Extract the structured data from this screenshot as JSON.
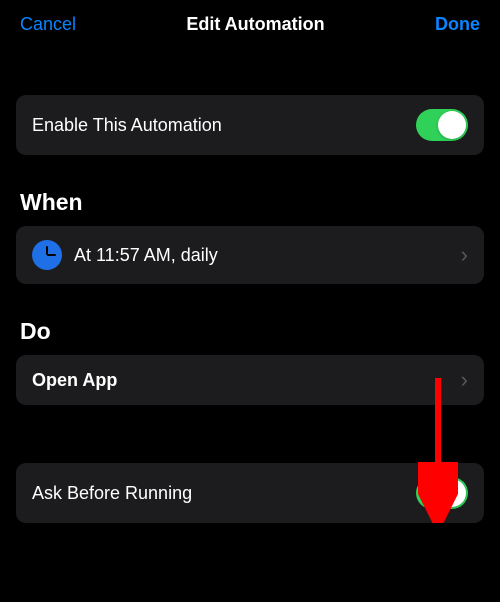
{
  "header": {
    "cancel": "Cancel",
    "title": "Edit Automation",
    "done": "Done"
  },
  "enable_row": {
    "label": "Enable This Automation",
    "toggle_on": true
  },
  "when": {
    "heading": "When",
    "schedule_text": "At 11:57 AM, daily"
  },
  "do": {
    "heading": "Do",
    "action_label": "Open App"
  },
  "ask_row": {
    "label": "Ask Before Running",
    "toggle_on": true
  }
}
